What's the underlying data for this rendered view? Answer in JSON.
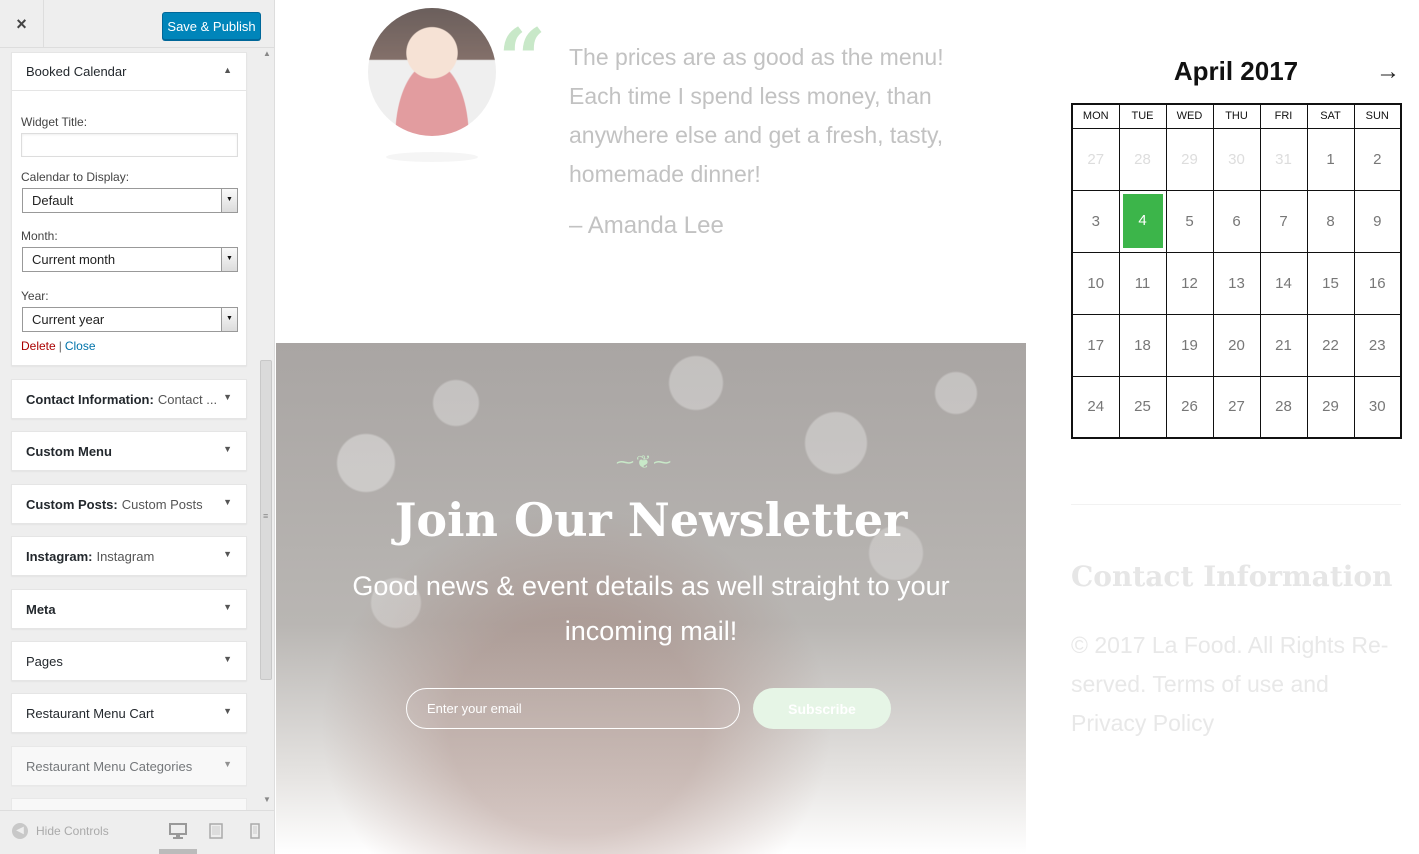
{
  "header": {
    "close_icon": "×",
    "publish_label": "Save & Publish"
  },
  "booked_widget": {
    "title": "Booked Calendar",
    "widget_title_label": "Widget Title:",
    "widget_title_value": "",
    "calendar_label": "Calendar to Display:",
    "calendar_value": "Default",
    "month_label": "Month:",
    "month_value": "Current month",
    "year_label": "Year:",
    "year_value": "Current year",
    "delete_label": "Delete",
    "separator": "|",
    "close_label": "Close"
  },
  "widgets": [
    {
      "title": "Contact Information:",
      "subtitle": "Contact ..."
    },
    {
      "title": "Custom Menu",
      "subtitle": ""
    },
    {
      "title": "Custom Posts:",
      "subtitle": "Custom Posts"
    },
    {
      "title": "Instagram:",
      "subtitle": "Instagram"
    },
    {
      "title": "Meta",
      "subtitle": ""
    },
    {
      "title": "Pages",
      "subtitle": ""
    },
    {
      "title": "Restaurant Menu Cart",
      "subtitle": ""
    },
    {
      "title": "Restaurant Menu Categories",
      "subtitle": ""
    }
  ],
  "footer": {
    "hide_controls_label": "Hide Controls",
    "devices": [
      "desktop-icon",
      "tablet-icon",
      "mobile-icon"
    ]
  },
  "testimonial": {
    "quote_mark": "“",
    "quote": "The prices are as good as the menu! Each time I spend less money, than anywhere else and get a fresh, tasty, homemade dinner!",
    "author": "– Amanda Lee"
  },
  "newsletter": {
    "ornament": "⁓❦⁓",
    "title": "Join Our Newsletter",
    "subtitle": "Good news & event details as well straight to your incoming mail!",
    "email_placeholder": "Enter your email",
    "submit_label": "Subscribe"
  },
  "calendar": {
    "title": "April 2017",
    "next_icon": "→",
    "weekdays": [
      "MON",
      "TUE",
      "WED",
      "THU",
      "FRI",
      "SAT",
      "SUN"
    ],
    "weeks": [
      [
        "27",
        "28",
        "29",
        "30",
        "31",
        "1",
        "2"
      ],
      [
        "3",
        "4",
        "5",
        "6",
        "7",
        "8",
        "9"
      ],
      [
        "10",
        "11",
        "12",
        "13",
        "14",
        "15",
        "16"
      ],
      [
        "17",
        "18",
        "19",
        "20",
        "21",
        "22",
        "23"
      ],
      [
        "24",
        "25",
        "26",
        "27",
        "28",
        "29",
        "30"
      ]
    ],
    "muted_cells": 5,
    "today": "4",
    "today_color": "#3cb54a"
  },
  "contact_info": {
    "title": "Contact Information",
    "text": "© 2017 La Food. All Rights Re-served. Terms of use and Privacy Policy"
  },
  "colors": {
    "publish_button": "#0085ba",
    "delete_link": "#aa0000",
    "close_link": "#0073aa",
    "accent_green": "#3cb54a"
  }
}
